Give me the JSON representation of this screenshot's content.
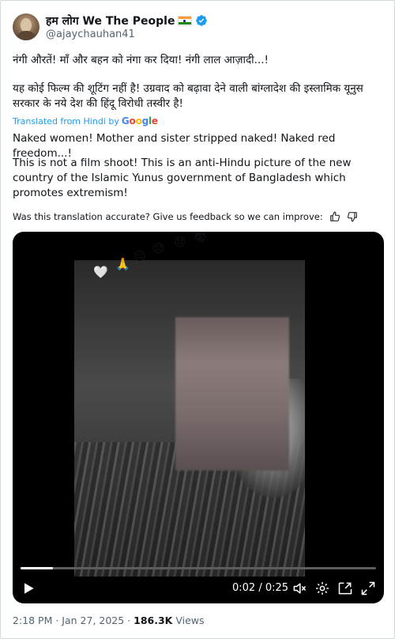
{
  "tweet": {
    "display_name": "हम लोग We The People",
    "handle": "@ajaychauhan41",
    "hindi_line1": "नंगी औरतें! माँ और बहन को नंगा कर दिया! नंगी लाल आज़ादी...!",
    "hindi_line2": "यह कोई फिल्म की शूटिंग नहीं है! उग्रवाद को बढ़ावा देने वाली बांग्लादेश की इस्लामिक यूनुस सरकार के नये देश की हिंदू विरोधी तस्वीर है!",
    "translated_label": "Translated from Hindi by",
    "google": [
      "G",
      "o",
      "o",
      "g",
      "l",
      "e"
    ],
    "english_line1": "Naked women! Mother and sister stripped naked! Naked red freedom...!",
    "english_line2": "This is not a film shoot! This is an anti-Hindu picture of the new country of the Islamic Yunus government of Bangladesh which promotes extremism!",
    "feedback_text": "Was this translation accurate? Give us feedback so we can improve:",
    "time": "2:18 PM",
    "date": "Jan 27, 2025",
    "views_count": "186.3K",
    "views_label": "Views"
  },
  "video": {
    "current_time": "0:02",
    "duration": "0:25",
    "time_separator": "/",
    "progress_fraction": 0.09,
    "emojis": [
      "🤍",
      "🙏",
      "😔",
      "😓",
      "😞",
      "😨"
    ]
  },
  "icons": {
    "verified": "verified-badge-icon",
    "flag": "india-flag-icon",
    "thumbs_up": "thumbs-up-icon",
    "thumbs_down": "thumbs-down-icon",
    "play": "play-icon",
    "mute": "mute-icon",
    "settings": "gear-icon",
    "pip": "picture-in-picture-icon",
    "fullscreen": "fullscreen-icon"
  },
  "colors": {
    "link": "#1d9bf0",
    "secondary_text": "#536471",
    "verified": "#1d9bf0"
  }
}
